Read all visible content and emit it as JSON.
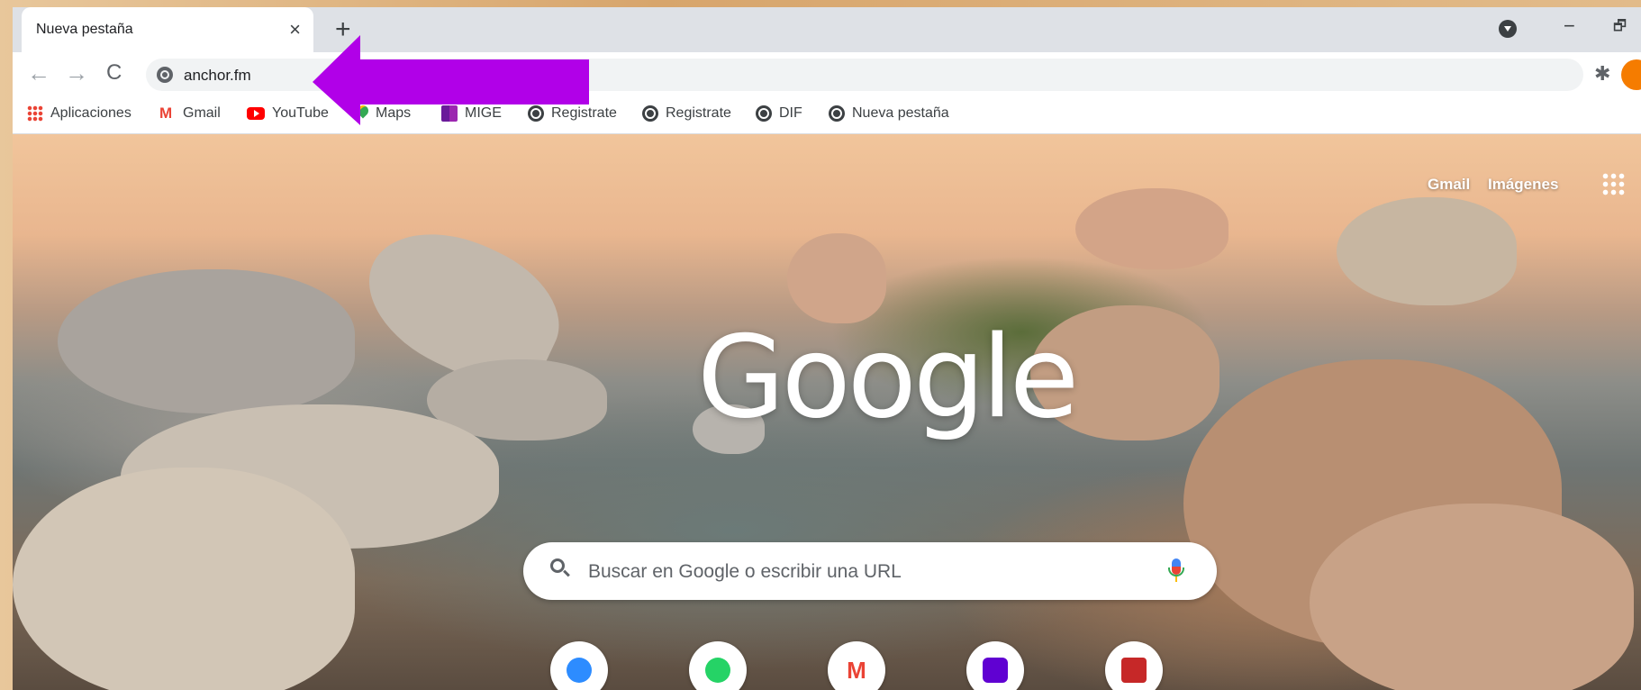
{
  "tab": {
    "title": "Nueva pestaña",
    "close_glyph": "×"
  },
  "new_tab_glyph": "+",
  "window_controls": {
    "minimize": "−",
    "maximize": "🗗"
  },
  "toolbar": {
    "back_glyph": "←",
    "forward_glyph": "→",
    "reload_glyph": "C",
    "url": "anchor.fm",
    "extensions_glyph": "✱"
  },
  "bookmarks": [
    {
      "label": "Aplicaciones",
      "icon": "apps-icon"
    },
    {
      "label": "Gmail",
      "icon": "gmail-icon"
    },
    {
      "label": "YouTube",
      "icon": "youtube-icon"
    },
    {
      "label": "Maps",
      "icon": "maps-icon"
    },
    {
      "label": "MIGE",
      "icon": "mige-icon"
    },
    {
      "label": "Registrate",
      "icon": "globe-icon"
    },
    {
      "label": "Registrate",
      "icon": "globe-icon"
    },
    {
      "label": "DIF",
      "icon": "globe-icon"
    },
    {
      "label": "Nueva pestaña",
      "icon": "globe-icon"
    }
  ],
  "ntp": {
    "gmail_link": "Gmail",
    "images_link": "Imágenes",
    "logo": "Google",
    "search_placeholder": "Buscar en Google o escribir una URL",
    "shortcuts": [
      {
        "icon": "zoom-icon",
        "color": "#2d8cff"
      },
      {
        "icon": "whatsapp-icon",
        "color": "#25d366"
      },
      {
        "icon": "gmail-icon",
        "color": "#ea4335"
      },
      {
        "icon": "mail-icon",
        "color": "#6001d2"
      },
      {
        "icon": "crest-icon",
        "color": "#c62828"
      }
    ]
  },
  "annotation": {
    "arrow_color": "#b100e8"
  }
}
